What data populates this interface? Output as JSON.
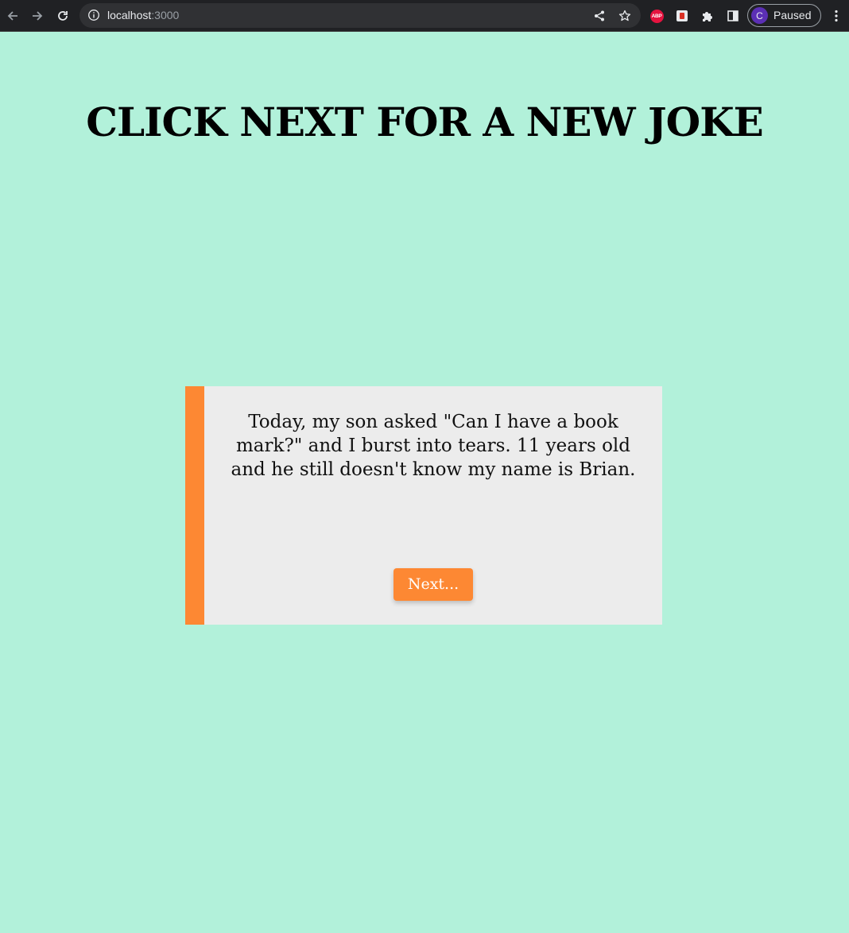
{
  "browser": {
    "url_host": "localhost",
    "url_port": ":3000",
    "profile_initial": "C",
    "profile_status": "Paused",
    "extensions": [
      {
        "name": "abp-icon",
        "label": "ABP"
      },
      {
        "name": "extension-icon"
      }
    ]
  },
  "page": {
    "title": "CLICK NEXT FOR A NEW JOKE",
    "background_color": "#b2f1da",
    "accent_color": "#fd8833",
    "card_color": "#ececec"
  },
  "joke": {
    "text": "Today, my son asked \"Can I have a book mark?\" and I burst into tears. 11 years old and he still doesn't know my name is Brian.",
    "next_label": "Next..."
  }
}
